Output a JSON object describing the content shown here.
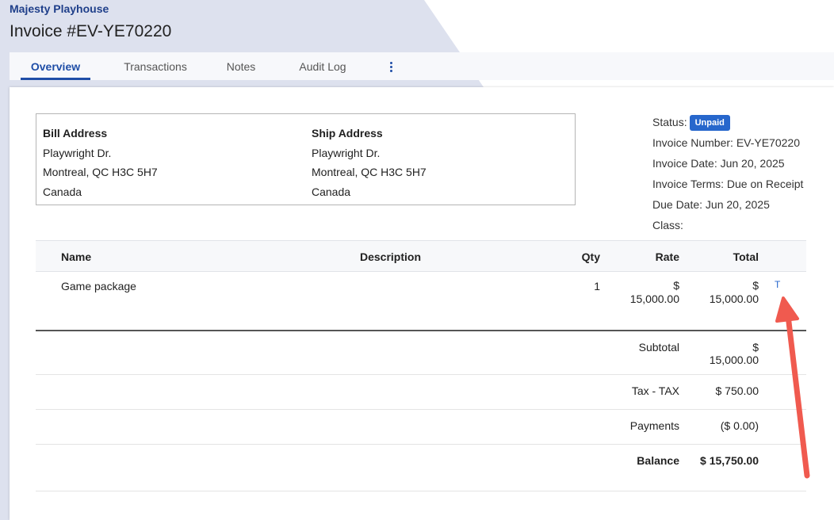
{
  "header": {
    "org_name": "Majesty Playhouse",
    "invoice_title": "Invoice #EV-YE70220"
  },
  "tabs": [
    {
      "label": "Overview",
      "active": true
    },
    {
      "label": "Transactions",
      "active": false
    },
    {
      "label": "Notes",
      "active": false
    },
    {
      "label": "Audit Log",
      "active": false
    }
  ],
  "bill_address": {
    "heading": "Bill Address",
    "line1": "Playwright Dr.",
    "line2": "Montreal, QC H3C 5H7",
    "line3": "Canada"
  },
  "ship_address": {
    "heading": "Ship Address",
    "line1": "Playwright Dr.",
    "line2": "Montreal, QC H3C 5H7",
    "line3": "Canada"
  },
  "meta": {
    "status_label": "Status:",
    "status_value": "Unpaid",
    "invoice_number": "Invoice Number: EV-YE70220",
    "invoice_date": "Invoice Date: Jun 20, 2025",
    "invoice_terms": "Invoice Terms: Due on Receipt",
    "due_date": "Due Date: Jun 20, 2025",
    "class": "Class:"
  },
  "table": {
    "headers": {
      "name": "Name",
      "description": "Description",
      "qty": "Qty",
      "rate": "Rate",
      "total": "Total"
    },
    "rows": [
      {
        "name": "Game package",
        "description": "",
        "qty": "1",
        "rate_cur": "$",
        "rate_amt": "15,000.00",
        "total_cur": "$",
        "total_amt": "15,000.00",
        "action": "T"
      }
    ]
  },
  "summary": {
    "subtotal_label": "Subtotal",
    "subtotal_cur": "$",
    "subtotal_amt": "15,000.00",
    "tax_label": "Tax - TAX",
    "tax_value": "$ 750.00",
    "payments_label": "Payments",
    "payments_value": "($ 0.00)",
    "balance_label": "Balance",
    "balance_value": "$ 15,750.00"
  },
  "colors": {
    "accent": "#1f4ea7",
    "badge": "#2767cc",
    "annotation_arrow": "#f05a4f"
  }
}
